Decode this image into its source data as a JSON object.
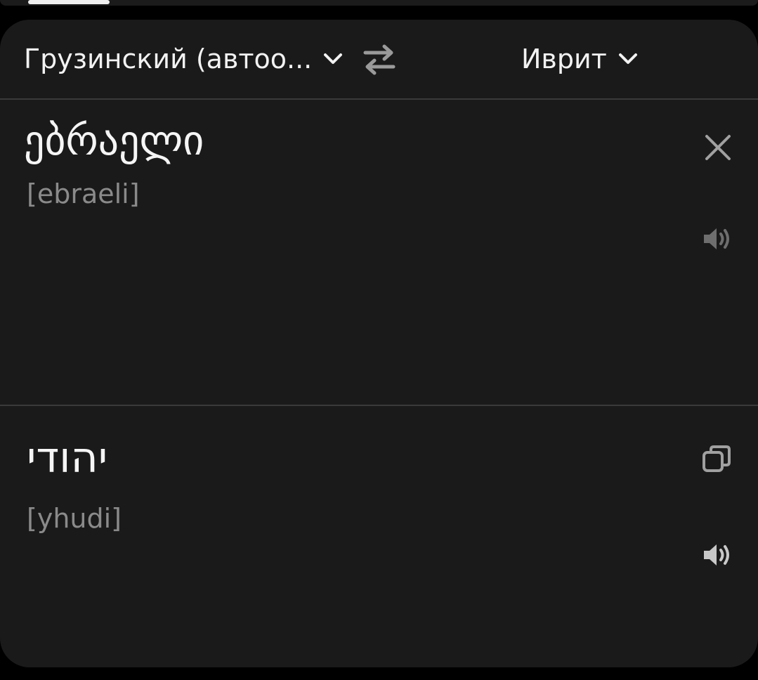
{
  "languages": {
    "source_label": "Грузинский (автоо...",
    "target_label": "Иврит"
  },
  "source": {
    "text": "ებრაელი",
    "transliteration": "[ebraeli]"
  },
  "result": {
    "text": "יהודי",
    "transliteration": "[yhudi]"
  },
  "icons": {
    "source_dropdown": "chevron-down-icon",
    "swap": "swap-arrows-icon",
    "target_dropdown": "chevron-down-icon",
    "clear": "close-icon",
    "source_speaker": "speaker-icon",
    "copy": "copy-icon",
    "result_speaker": "speaker-icon"
  },
  "colors": {
    "background": "#000000",
    "card": "#1a1a1a",
    "text_primary": "#f5f5f5",
    "text_secondary": "#8a8a8a",
    "icon_muted": "#9a9a9a",
    "divider": "#3a3a3a"
  }
}
